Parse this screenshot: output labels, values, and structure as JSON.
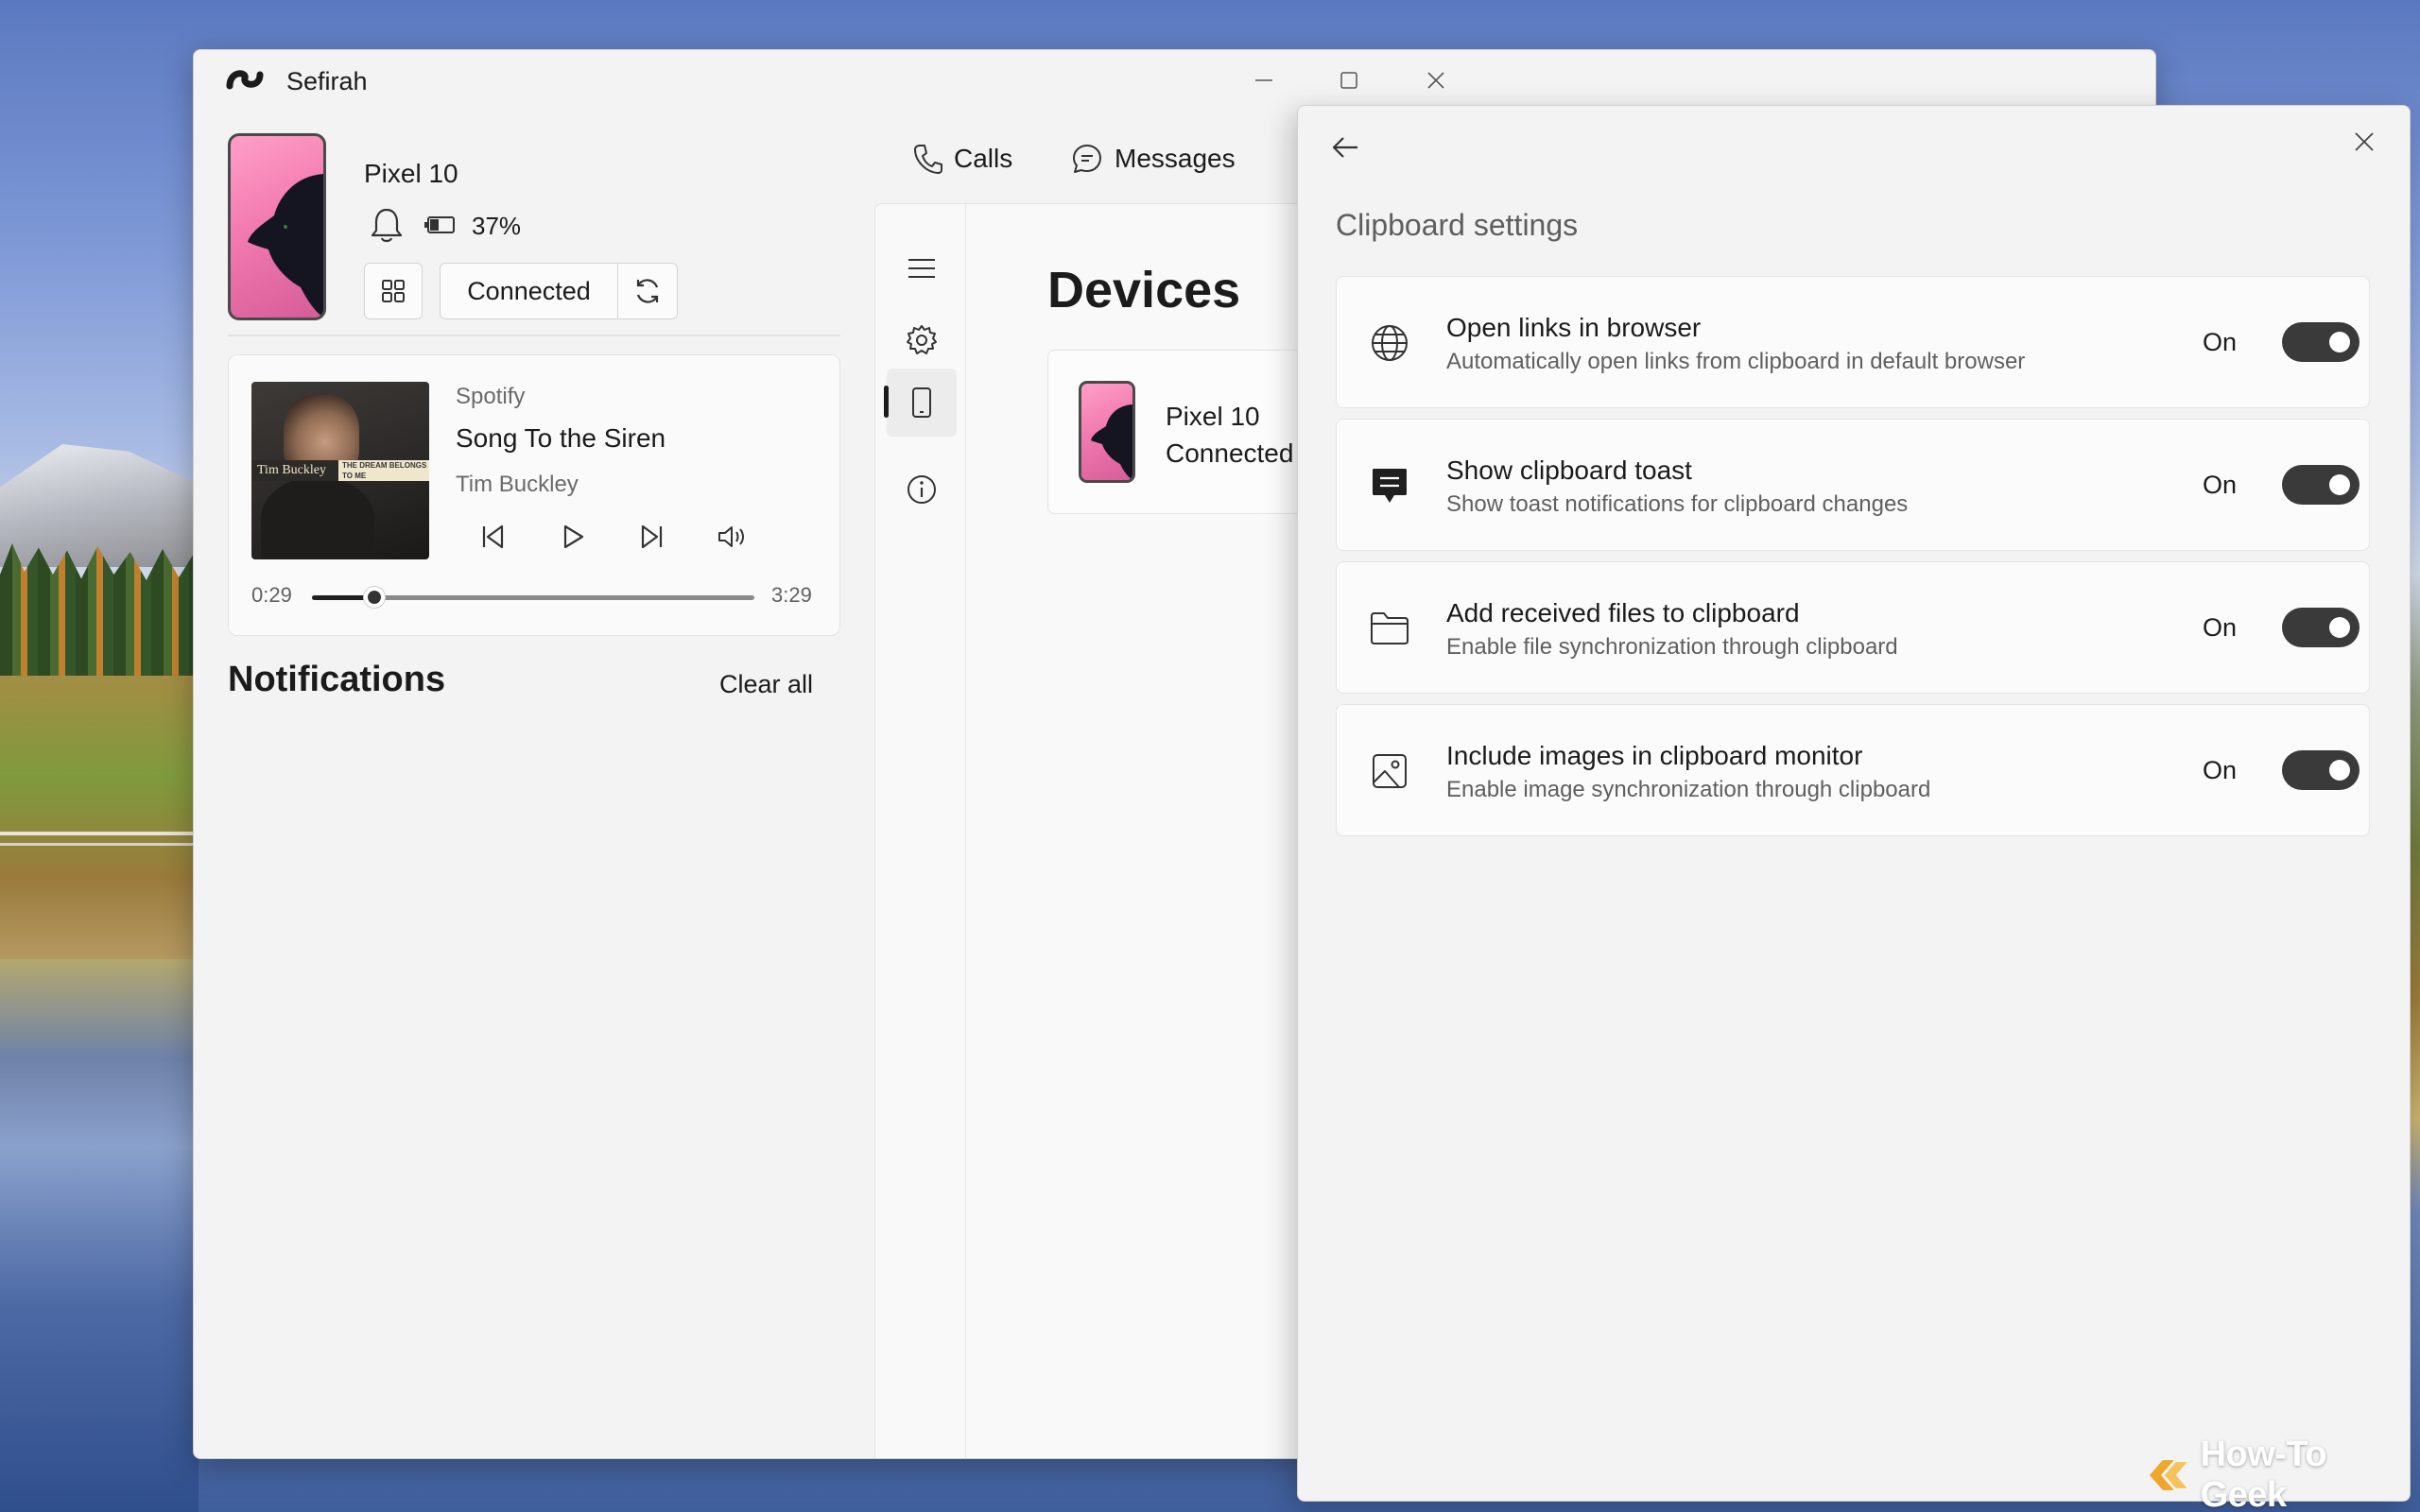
{
  "app": {
    "title": "Sefirah"
  },
  "device": {
    "name": "Pixel 10",
    "battery": "37%",
    "connection": "Connected"
  },
  "media": {
    "source": "Spotify",
    "song": "Song To the Siren",
    "artist": "Tim Buckley",
    "album_artist_text": "Tim Buckley",
    "album_tagline": "THE DREAM BELONGS TO ME",
    "time_current": "0:29",
    "time_total": "3:29",
    "progress_fraction": 0.14
  },
  "notifications": {
    "title": "Notifications",
    "clear_label": "Clear all"
  },
  "tabs": [
    {
      "label": "Calls",
      "icon": "phone-icon"
    },
    {
      "label": "Messages",
      "icon": "chat-icon"
    }
  ],
  "nav": [
    {
      "icon": "hamburger-icon"
    },
    {
      "icon": "gear-icon"
    },
    {
      "icon": "device-icon",
      "active": true
    },
    {
      "icon": "info-icon"
    }
  ],
  "devices_page": {
    "title": "Devices",
    "card": {
      "name": "Pixel 10",
      "status": "Connected"
    }
  },
  "clipboard_settings": {
    "title": "Clipboard settings",
    "items": [
      {
        "icon": "globe-icon",
        "title": "Open links in browser",
        "description": "Automatically open links from clipboard in default browser",
        "state": "On"
      },
      {
        "icon": "toast-message-icon",
        "title": "Show clipboard toast",
        "description": "Show toast notifications for clipboard changes",
        "state": "On"
      },
      {
        "icon": "folder-icon",
        "title": "Add received files to clipboard",
        "description": "Enable file synchronization through clipboard",
        "state": "On"
      },
      {
        "icon": "image-icon",
        "title": "Include images in clipboard monitor",
        "description": "Enable image synchronization through clipboard",
        "state": "On"
      }
    ]
  },
  "watermark": {
    "text": "How-To Geek"
  },
  "colors": {
    "toggle_on": "#3a3a3a",
    "phone_wallpaper": "#f27bb0"
  }
}
